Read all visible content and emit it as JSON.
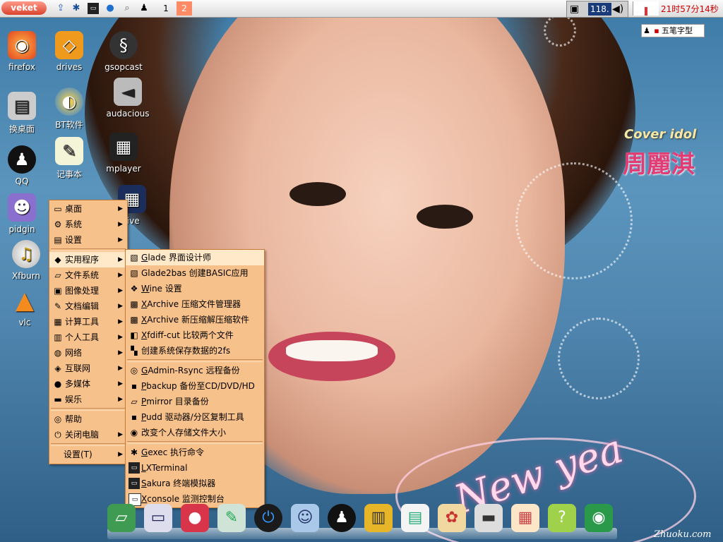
{
  "panel": {
    "start_label": "veket",
    "workspaces": [
      "1",
      "2"
    ],
    "tray_value": "118.",
    "clock": "21时57分14秒"
  },
  "ime": {
    "label": "五笔字型"
  },
  "wallpaper": {
    "cover_title": "Cover idol",
    "cover_name": "周麗淇",
    "watermark": "Zhuoku.com",
    "neon_text": "New yea"
  },
  "desktop_icons": [
    {
      "label": "firefox",
      "icon": "firefox-icon"
    },
    {
      "label": "drives",
      "icon": "drive-icon"
    },
    {
      "label": "gsopcast",
      "icon": "gsopcast-icon"
    },
    {
      "label": "换桌面",
      "icon": "change-desktop-icon"
    },
    {
      "label": "BT软件",
      "icon": "bt-icon"
    },
    {
      "label": "audacious",
      "icon": "speaker-icon"
    },
    {
      "label": "QQ",
      "icon": "qq-penguin-icon"
    },
    {
      "label": "记事本",
      "icon": "notepad-icon"
    },
    {
      "label": "mplayer",
      "icon": "film-icon"
    },
    {
      "label": "pidgin",
      "icon": "pidgin-icon"
    },
    {
      "label": "live",
      "icon": "live-icon"
    },
    {
      "label": "Xfburn",
      "icon": "music-disc-icon"
    },
    {
      "label": "vlc",
      "icon": "vlc-cone-icon"
    }
  ],
  "main_menu": {
    "items": [
      {
        "label": "桌面",
        "icon": "desktop-icon",
        "submenu": true
      },
      {
        "label": "系统",
        "icon": "system-icon",
        "submenu": true
      },
      {
        "label": "设置",
        "icon": "settings-icon",
        "submenu": true
      },
      {
        "label": "实用程序",
        "icon": "utility-icon",
        "submenu": true,
        "active": true
      },
      {
        "label": "文件系统",
        "icon": "folder-icon",
        "submenu": true
      },
      {
        "label": "图像处理",
        "icon": "image-icon",
        "submenu": true
      },
      {
        "label": "文档编辑",
        "icon": "document-icon",
        "submenu": true
      },
      {
        "label": "计算工具",
        "icon": "calculator-icon",
        "submenu": true
      },
      {
        "label": "个人工具",
        "icon": "personal-icon",
        "submenu": true
      },
      {
        "label": "网络",
        "icon": "network-icon",
        "submenu": true
      },
      {
        "label": "互联网",
        "icon": "internet-icon",
        "submenu": true
      },
      {
        "label": "多媒体",
        "icon": "multimedia-icon",
        "submenu": true
      },
      {
        "label": "娱乐",
        "icon": "game-icon",
        "submenu": true
      },
      {
        "label": "帮助",
        "icon": "help-icon",
        "submenu": false
      },
      {
        "label": "关闭电脑",
        "icon": "power-icon",
        "submenu": true
      },
      {
        "label": "设置(T)",
        "icon": "",
        "submenu": true
      }
    ]
  },
  "submenu": {
    "items": [
      {
        "mnemonic": "G",
        "rest": "lade 界面设计师",
        "icon": "glade-icon"
      },
      {
        "mnemonic": "",
        "rest": "Glade2bas 创建BASIC应用",
        "icon": "glade2bas-icon"
      },
      {
        "mnemonic": "W",
        "rest": "ine 设置",
        "icon": "wine-icon"
      },
      {
        "mnemonic": "X",
        "rest": "Archive 压缩文件管理器",
        "icon": "archive-icon"
      },
      {
        "mnemonic": "X",
        "rest": "Archive 新压缩解压缩软件",
        "icon": "archive-new-icon"
      },
      {
        "mnemonic": "X",
        "rest": "fdiff-cut 比较两个文件",
        "icon": "diff-icon"
      },
      {
        "mnemonic": "",
        "rest": "创建系统保存数据的2fs",
        "icon": "checker-icon"
      },
      {
        "mnemonic": "G",
        "rest": "Admin-Rsync 远程备份",
        "icon": "rsync-icon"
      },
      {
        "mnemonic": "P",
        "rest": "backup 备份至CD/DVD/HD",
        "icon": "floppy-icon"
      },
      {
        "mnemonic": "P",
        "rest": "mirror 目录备份",
        "icon": "folder-mirror-icon"
      },
      {
        "mnemonic": "P",
        "rest": "udd 驱动器/分区复制工具",
        "icon": "floppy-icon"
      },
      {
        "mnemonic": "",
        "rest": "改变个人存储文件大小",
        "icon": "resize-icon"
      },
      {
        "mnemonic": "G",
        "rest": "exec 执行命令",
        "icon": "gear-icon"
      },
      {
        "mnemonic": "L",
        "rest": "XTerminal",
        "icon": "terminal-icon"
      },
      {
        "mnemonic": "S",
        "rest": "akura 终端模拟器",
        "icon": "terminal-icon"
      },
      {
        "mnemonic": "X",
        "rest": "console 监测控制台",
        "icon": "console-icon"
      }
    ]
  },
  "dock": [
    "folder-icon",
    "monitor-icon",
    "pig-icon",
    "editor-icon",
    "power-icon",
    "users-icon",
    "qq-penguin-icon",
    "book-icon",
    "chart-icon",
    "paint-icon",
    "usb-icon",
    "calendar-icon",
    "help-icon",
    "camera-icon"
  ],
  "colors": {
    "menu_bg": "#f7c18c",
    "menu_active": "#ffe9c8",
    "clock": "#cc0000"
  }
}
